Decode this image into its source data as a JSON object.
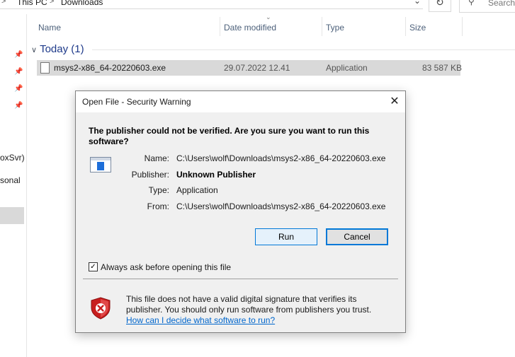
{
  "explorer": {
    "breadcrumb": [
      "This PC",
      "Downloads"
    ],
    "breadcrumb_sep": ">",
    "search_placeholder": "Search",
    "nav_partial": [
      "oxSvr)",
      "sonal"
    ],
    "columns": [
      "Name",
      "Date modified",
      "Type",
      "Size"
    ],
    "group": {
      "label": "Today (1)",
      "chevron": "∨"
    },
    "file": {
      "name": "msys2-x86_64-20220603.exe",
      "date": "29.07.2022 12.41",
      "type": "Application",
      "size": "83 587 KB"
    }
  },
  "dialog": {
    "title": "Open File - Security Warning",
    "close_symbol": "✕",
    "question": "The publisher could not be verified.  Are you sure you want to run this software?",
    "fields": [
      {
        "label": "Name:",
        "value": "C:\\Users\\wolf\\Downloads\\msys2-x86_64-20220603.exe",
        "bold": false
      },
      {
        "label": "Publisher:",
        "value": "Unknown Publisher",
        "bold": true
      },
      {
        "label": "Type:",
        "value": "Application",
        "bold": false
      },
      {
        "label": "From:",
        "value": "C:\\Users\\wolf\\Downloads\\msys2-x86_64-20220603.exe",
        "bold": false
      }
    ],
    "run_label": "Run",
    "cancel_label": "Cancel",
    "checkbox": {
      "label": "Always ask before opening this file",
      "checked": true
    },
    "warning_text": "This file does not have a valid digital signature that verifies its publisher.  You should only run software from publishers you trust.",
    "help_link": "How can I decide what software to run?"
  },
  "colors": {
    "accent": "#0078d7",
    "link": "#0066cc",
    "shield": "#c81e1e"
  }
}
